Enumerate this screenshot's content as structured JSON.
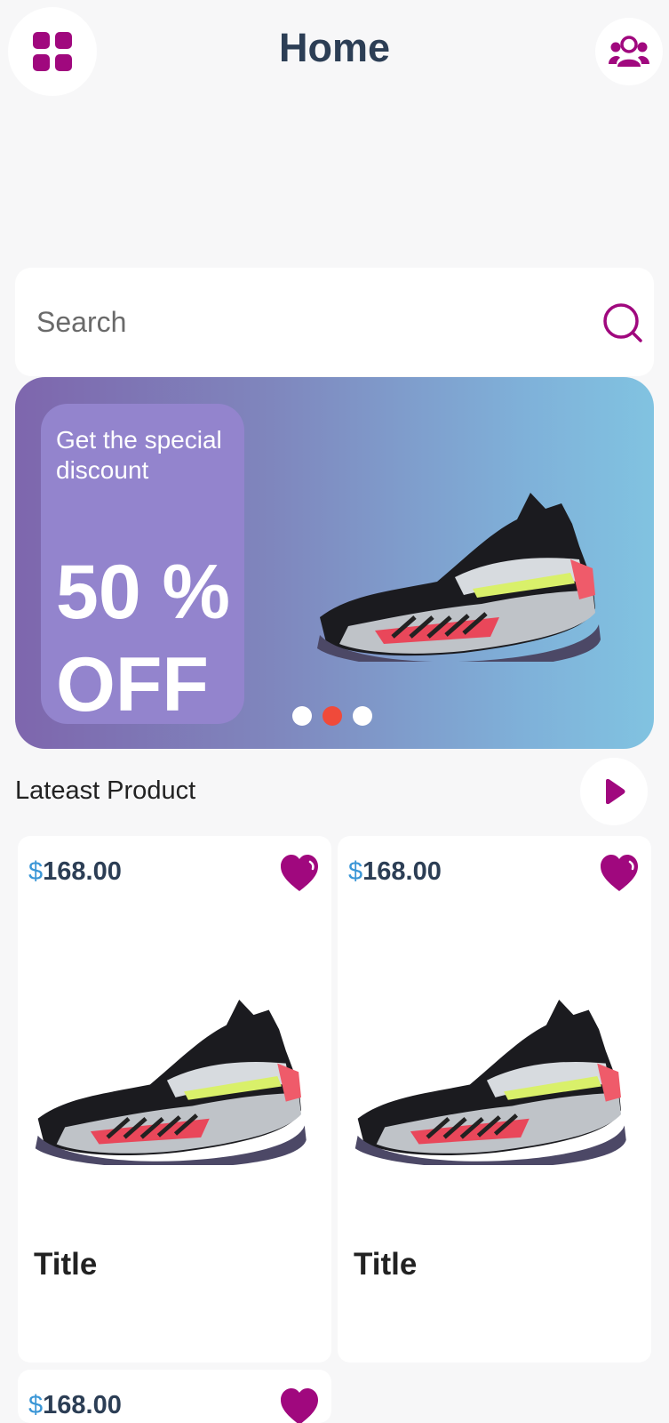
{
  "header": {
    "title": "Home",
    "menu_icon": "grid-icon",
    "profile_icon": "users-icon"
  },
  "search": {
    "placeholder": "Search",
    "icon": "search-icon"
  },
  "banner": {
    "subtitle": "Get the special discount",
    "headline": "50 % OFF",
    "image": "sneaker",
    "carousel": {
      "dots": 3,
      "active_index": 1
    }
  },
  "latest": {
    "label": "Lateast Product",
    "icon": "play-icon"
  },
  "products": [
    {
      "currency": "$",
      "price": "168.00",
      "title": "Title",
      "favorite": true
    },
    {
      "currency": "$",
      "price": "168.00",
      "title": "Title",
      "favorite": true
    },
    {
      "currency": "$",
      "price": "168.00",
      "title": "",
      "favorite": true
    }
  ],
  "colors": {
    "accent": "#a0087e",
    "title": "#2c3e55",
    "currency": "#3a96d6",
    "banner_start": "#7e66ad",
    "banner_end": "#81c3e1",
    "promo_box": "#9384cd",
    "dot_active": "#f04a3a",
    "background": "#f7f7f8"
  }
}
